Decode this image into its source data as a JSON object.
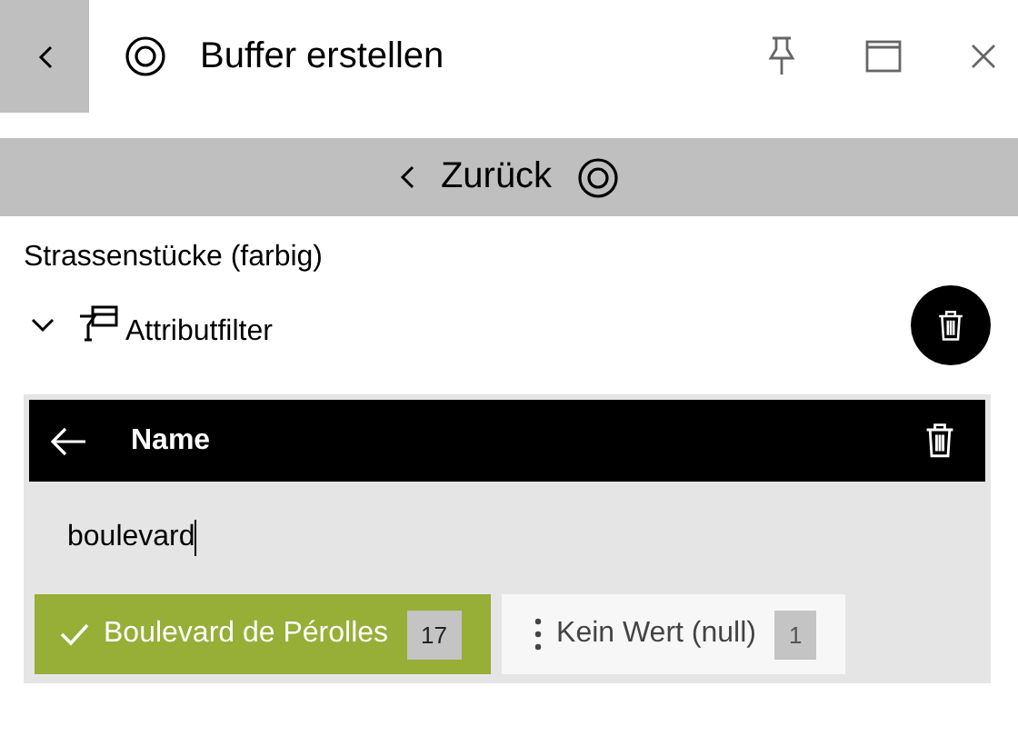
{
  "window": {
    "title": "Buffer erstellen"
  },
  "nav": {
    "label": "Zurück"
  },
  "layer": {
    "title": "Strassenstücke (farbig)"
  },
  "filter": {
    "label": "Attributfilter",
    "expanded": true
  },
  "attribute_panel": {
    "title": "Name",
    "search": {
      "value": "boulevard"
    },
    "values": [
      {
        "label": "Boulevard de Pérolles",
        "count": "17",
        "selected": true
      },
      {
        "label": "Kein Wert (null)",
        "count": "1",
        "selected": false
      }
    ]
  }
}
